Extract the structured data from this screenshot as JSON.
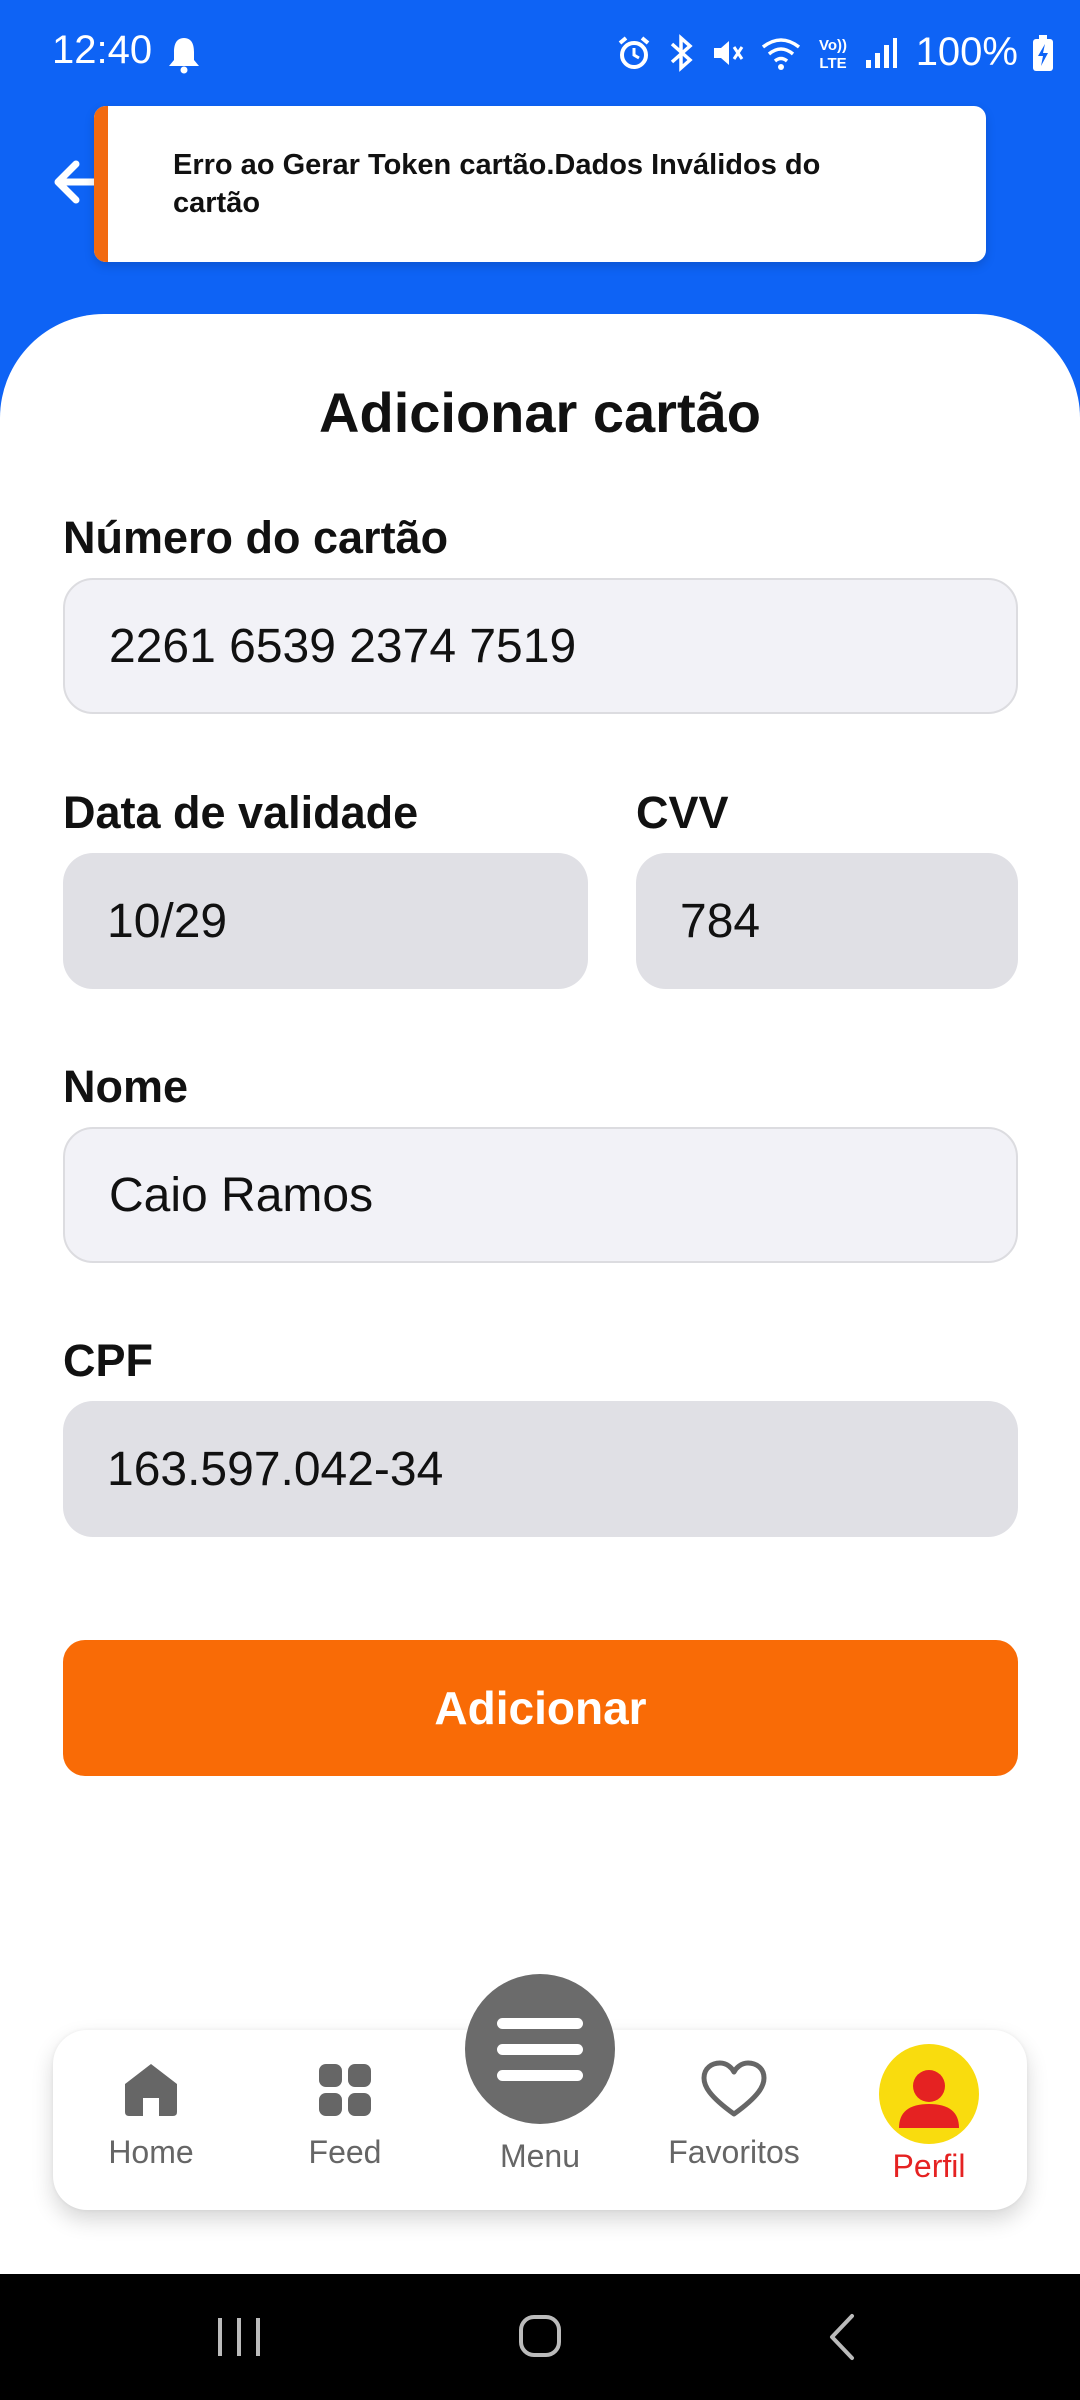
{
  "status_bar": {
    "time": "12:40",
    "battery": "100%",
    "icons": [
      "bell-icon",
      "alarm-icon",
      "bluetooth-icon",
      "mute-icon",
      "wifi-icon",
      "volte-icon",
      "signal-icon",
      "battery-charging-icon"
    ]
  },
  "toast": {
    "message": "Erro ao Gerar Token cartão.Dados Inválidos do cartão",
    "accent_color": "#f26a10"
  },
  "page": {
    "title": "Adicionar cartão"
  },
  "form": {
    "card_number": {
      "label": "Número do cartão",
      "value": "2261 6539 2374 7519"
    },
    "expiry": {
      "label": "Data de validade",
      "value": "10/29"
    },
    "cvv": {
      "label": "CVV",
      "value": "784"
    },
    "name": {
      "label": "Nome",
      "value": "Caio Ramos"
    },
    "cpf": {
      "label": "CPF",
      "value": "163.597.042-34"
    },
    "submit_label": "Adicionar"
  },
  "bottom_nav": {
    "items": [
      {
        "label": "Home",
        "icon": "home-icon"
      },
      {
        "label": "Feed",
        "icon": "grid-icon"
      },
      {
        "label": "Menu",
        "icon": "menu-icon"
      },
      {
        "label": "Favoritos",
        "icon": "heart-icon"
      },
      {
        "label": "Perfil",
        "icon": "user-icon",
        "active": true
      }
    ],
    "active_color": "#e52222"
  },
  "colors": {
    "header_blue": "#0e63f5",
    "primary_orange": "#f96b06",
    "avatar_yellow": "#f9dc0e"
  }
}
